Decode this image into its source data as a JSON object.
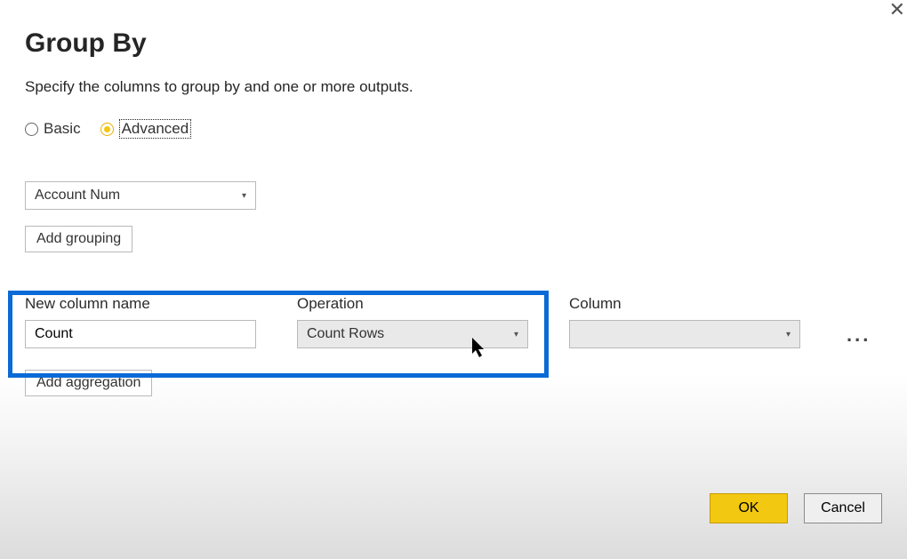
{
  "title": "Group By",
  "subtitle": "Specify the columns to group by and one or more outputs.",
  "mode": {
    "basic_label": "Basic",
    "advanced_label": "Advanced",
    "selected": "advanced"
  },
  "group_column": {
    "value": "Account Num"
  },
  "buttons": {
    "add_grouping": "Add grouping",
    "add_aggregation": "Add aggregation",
    "ok": "OK",
    "cancel": "Cancel",
    "more": "..."
  },
  "labels": {
    "new_column_name": "New column name",
    "operation": "Operation",
    "column": "Column"
  },
  "aggregation": {
    "new_column_name_value": "Count",
    "operation_value": "Count Rows",
    "column_value": ""
  }
}
